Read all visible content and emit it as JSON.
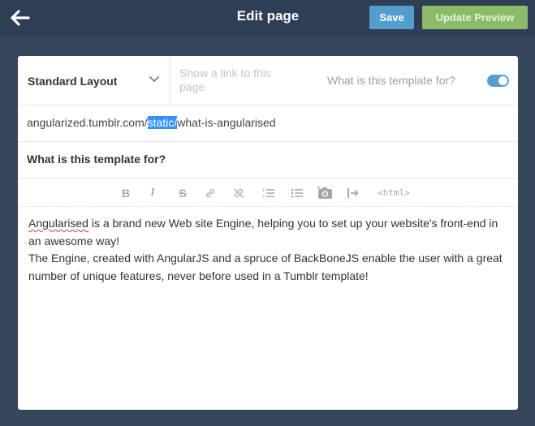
{
  "header": {
    "title": "Edit page",
    "save_label": "Save",
    "preview_label": "Update Preview"
  },
  "colors": {
    "background": "#36465d",
    "header": "#2e3e54",
    "save": "#529ecc",
    "preview": "#8bbb67",
    "toggle": "#529ecc",
    "url_highlight": "#3390ff"
  },
  "settings": {
    "layout_selected": "Standard Layout",
    "link_placeholder": "Show a link to this page",
    "template_label": "What is this template for?",
    "toggle_on": true
  },
  "url": {
    "prefix": "angularized.tumblr.com/",
    "highlight": "static/",
    "suffix": "what-is-angularised"
  },
  "page_title": "What is this template for?",
  "toolbar": {
    "items": [
      "bold-icon",
      "italic-icon",
      "strikethrough-icon",
      "link-icon",
      "unlink-icon",
      "ordered-list-icon",
      "unordered-list-icon",
      "insert-image-icon",
      "read-more-icon"
    ],
    "html_label": "<html>"
  },
  "editor": {
    "misspelled_word": "Angularised",
    "line1_rest": " is a brand new Web site Engine, helping you to set up your website's front-end in an awesome way!",
    "line2": "The Engine, created with AngularJS and a spruce of BackBoneJS enable the user with a great number of unique features, never before used in a Tumblr template!"
  }
}
